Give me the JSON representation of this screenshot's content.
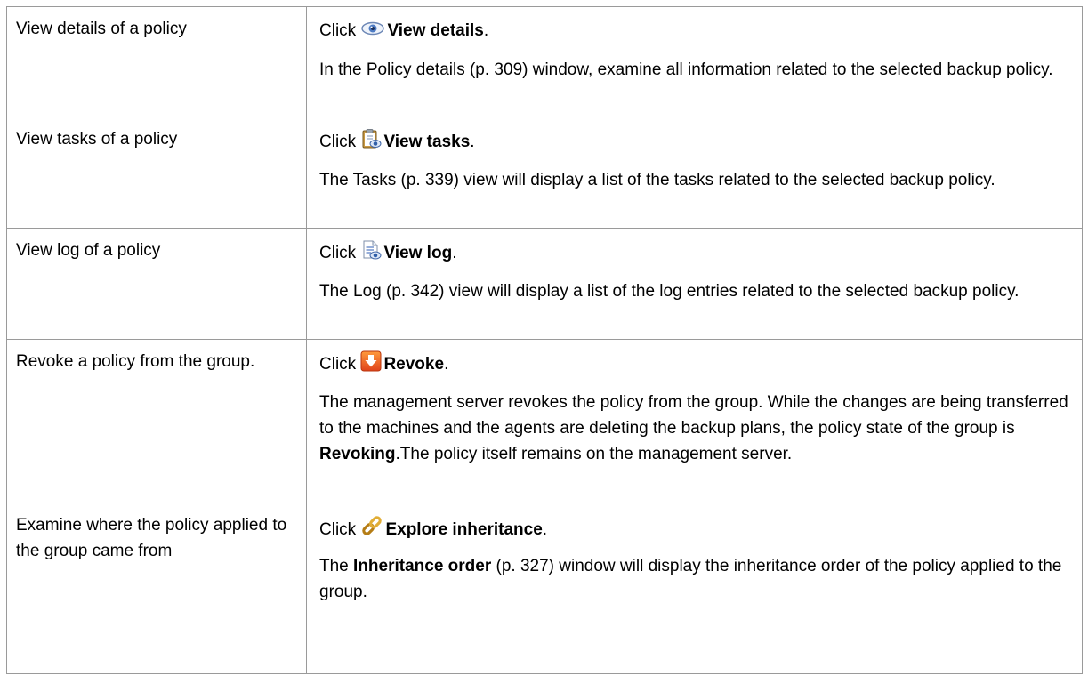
{
  "rows": [
    {
      "action": "View details of a policy",
      "click_prefix": "Click",
      "command": "View details",
      "icon": "eye-icon",
      "desc_parts": [
        "In the Policy details (p. 309) window, examine all information related to the selected backup policy."
      ]
    },
    {
      "action": "View tasks of a policy",
      "click_prefix": "Click",
      "command": "View tasks",
      "icon": "clipboard-tasks-icon",
      "desc_parts": [
        "The Tasks (p. 339) view will display a list of the tasks related to the selected backup policy."
      ]
    },
    {
      "action": "View log of a policy",
      "click_prefix": "Click",
      "command": "View log",
      "icon": "log-document-icon",
      "desc_parts": [
        "The Log (p. 342) view will display a list of the log entries related to the selected backup policy."
      ]
    },
    {
      "action": "Revoke a policy from the group.",
      "click_prefix": "Click",
      "command": "Revoke",
      "icon": "revoke-arrow-icon",
      "desc_parts": [
        "The management server revokes the policy from the group. While the changes are being transferred to the machines and the agents are deleting the backup plans, the policy state of the group is ",
        "Revoking",
        ".The policy itself remains on the management server."
      ]
    },
    {
      "action": "Examine where the policy applied to the group came from",
      "click_prefix": "Click",
      "command": "Explore inheritance",
      "icon": "chain-link-icon",
      "desc_parts": [
        "Inheritance order",
        " (p. 327) window will display the inheritance order of the policy applied to the group."
      ],
      "desc_prefix": "The "
    }
  ],
  "punct": "."
}
